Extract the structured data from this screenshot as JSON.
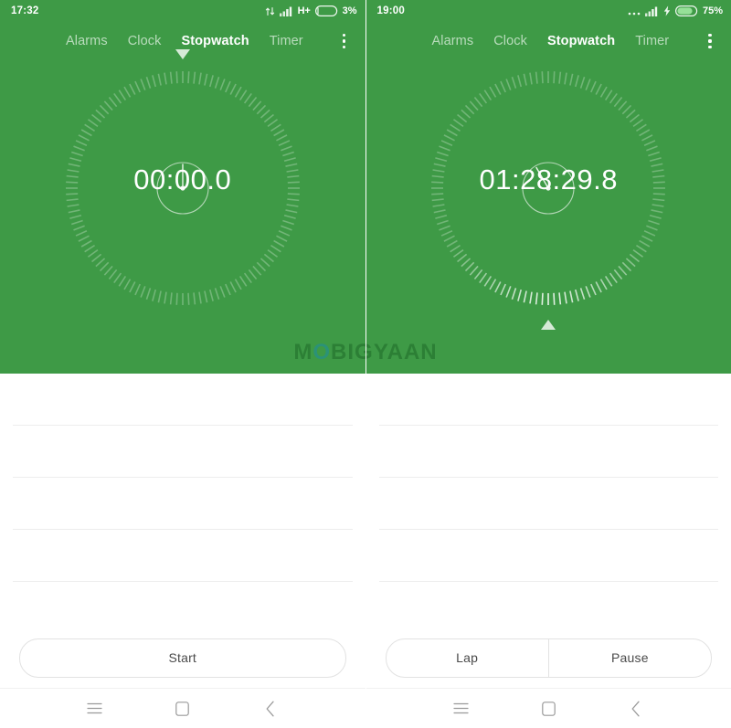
{
  "app": {
    "name": "Clock",
    "accent_green": "#3e9a46",
    "tab_inactive_color": "#b9dcbc",
    "tab_active_color": "#ffffff"
  },
  "watermark": {
    "text_before": "M",
    "text_o": "O",
    "text_after": "BIGYAAN",
    "full": "MOBIGYAAN"
  },
  "panels": [
    {
      "id": "stopwatch-idle",
      "status": {
        "time": "17:32",
        "icons": [
          "data-transfer-icon",
          "signal-bars-icon"
        ],
        "network": "H+",
        "charging": false,
        "battery_percent": "3%",
        "battery_level": 3
      },
      "tabs": [
        {
          "label": "Alarms",
          "active": false
        },
        {
          "label": "Clock",
          "active": false
        },
        {
          "label": "Stopwatch",
          "active": true
        },
        {
          "label": "Timer",
          "active": false
        }
      ],
      "overflow_menu": "more-options",
      "stopwatch": {
        "display": "00:00.0",
        "running": false,
        "marker_position": "top",
        "subdial_hand_degrees": 0,
        "progress_degrees": 0
      },
      "laps": [],
      "lap_rows_visible": 5,
      "buttons": [
        {
          "label": "Start",
          "name": "start-button"
        }
      ],
      "navbar": [
        {
          "name": "recents-button",
          "glyph": "menu"
        },
        {
          "name": "home-button",
          "glyph": "square"
        },
        {
          "name": "back-button",
          "glyph": "chevron-left"
        }
      ]
    },
    {
      "id": "stopwatch-running",
      "status": {
        "time": "19:00",
        "icons": [
          "more-dots-icon",
          "signal-bars-icon"
        ],
        "network": "",
        "charging": true,
        "battery_percent": "75%",
        "battery_level": 75
      },
      "tabs": [
        {
          "label": "Alarms",
          "active": false
        },
        {
          "label": "Clock",
          "active": false
        },
        {
          "label": "Stopwatch",
          "active": true
        },
        {
          "label": "Timer",
          "active": false
        }
      ],
      "overflow_menu": "more-options",
      "stopwatch": {
        "display": "01:28:29.8",
        "running": true,
        "marker_position": "bottom",
        "subdial_hand_degrees": 330,
        "progress_degrees": 180
      },
      "laps": [],
      "lap_rows_visible": 5,
      "buttons": [
        {
          "label": "Lap",
          "name": "lap-button"
        },
        {
          "label": "Pause",
          "name": "pause-button"
        }
      ],
      "navbar": [
        {
          "name": "recents-button",
          "glyph": "menu"
        },
        {
          "name": "home-button",
          "glyph": "square"
        },
        {
          "name": "back-button",
          "glyph": "chevron-left"
        }
      ]
    }
  ]
}
